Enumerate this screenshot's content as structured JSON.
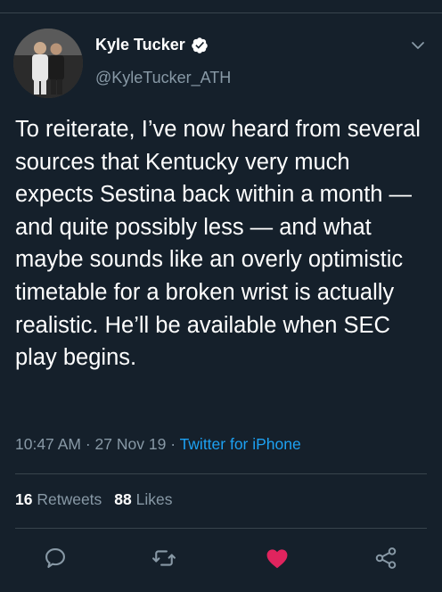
{
  "author": {
    "display_name": "Kyle Tucker",
    "handle": "@KyleTucker_ATH",
    "verified": true
  },
  "tweet": {
    "text": "To reiterate, I’ve now heard from several sources that Kentucky very much expects Sestina back within a month — and quite possibly less — and what maybe sounds like an overly optimistic timetable for a broken wrist is actually realistic. He’ll be available when SEC play begins.",
    "time": "10:47 AM",
    "separator": "·",
    "date": "27 Nov 19",
    "source": "Twitter for iPhone"
  },
  "stats": {
    "retweets_count": "16",
    "retweets_label": "Retweets",
    "likes_count": "88",
    "likes_label": "Likes"
  },
  "actions": {
    "reply_icon": "reply-icon",
    "retweet_icon": "retweet-icon",
    "like_icon": "heart-icon",
    "share_icon": "share-icon"
  },
  "colors": {
    "background": "#15202b",
    "text": "#ffffff",
    "secondary": "#8899a6",
    "link": "#1da1f2",
    "verified": "#ffffff",
    "like": "#e0245e",
    "divider": "#38444d"
  }
}
